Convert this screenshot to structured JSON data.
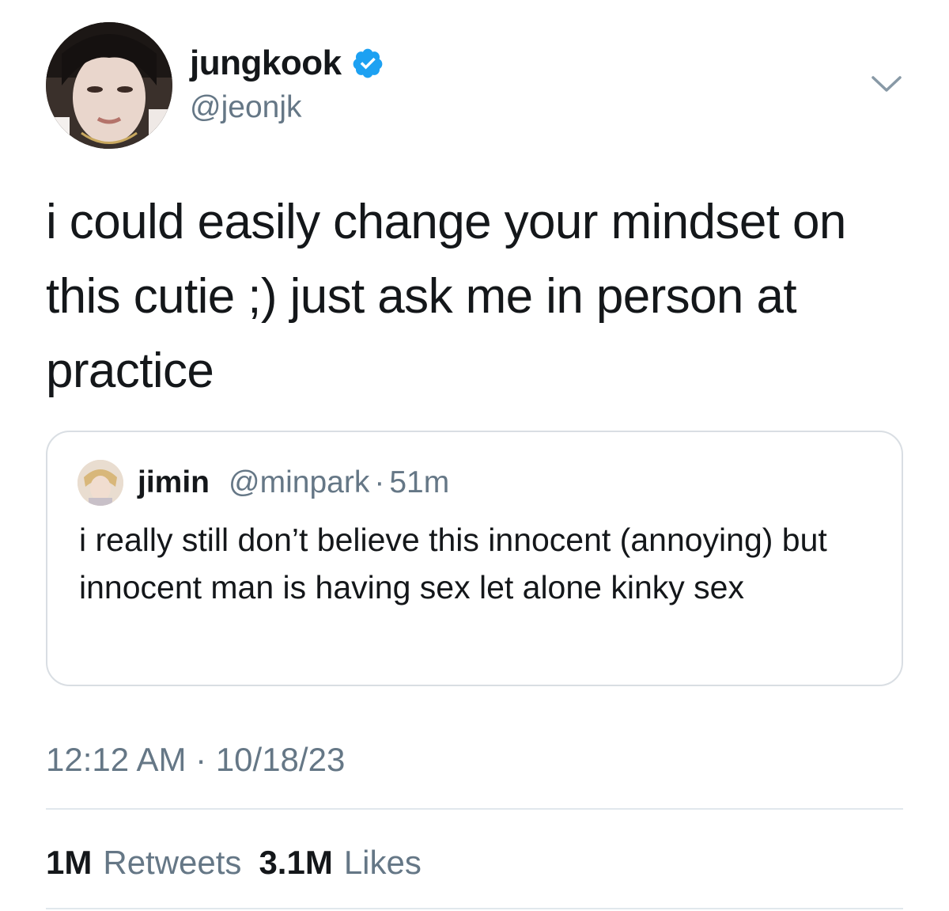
{
  "tweet": {
    "author": {
      "display_name": "jungkook",
      "handle": "@jeonjk",
      "verified": true,
      "verified_color": "#1da1f2"
    },
    "text": "i could easily change your mindset on this cutie ;) just ask me in person at practice",
    "timestamp": {
      "time": "12:12 AM",
      "separator": "·",
      "date": "10/18/23"
    },
    "stats": {
      "retweets_value": "1M",
      "retweets_label": "Retweets",
      "likes_value": "3.1M",
      "likes_label": "Likes"
    }
  },
  "quoted_tweet": {
    "display_name": "jimin",
    "handle": "@minpark",
    "separator": "·",
    "time_ago": "51m",
    "text": "i really still don’t believe this innocent (annoying) but innocent man is having sex let alone kinky sex"
  },
  "icons": {
    "more": "chevron-down-icon",
    "verified": "verified-badge-icon"
  },
  "colors": {
    "primary_text": "#14171a",
    "secondary_text": "#657786",
    "border": "#d9dee3",
    "accent": "#1da1f2"
  }
}
